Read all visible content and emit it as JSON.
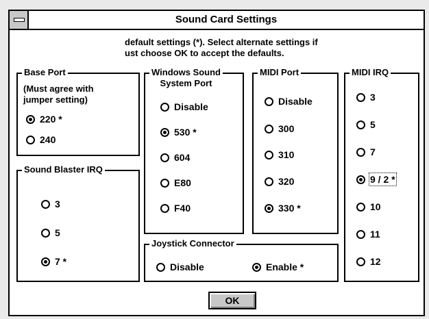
{
  "window": {
    "title": "Sound Card Settings"
  },
  "intro": {
    "line1": "default settings (*). Select alternate settings if",
    "line2": "ust choose OK to accept the defaults."
  },
  "base_port": {
    "legend": "Base Port",
    "note_line1": "(Must agree with",
    "note_line2": "jumper setting)",
    "options": [
      {
        "label": "220 *",
        "selected": true
      },
      {
        "label": "240",
        "selected": false
      }
    ]
  },
  "sound_blaster_irq": {
    "legend": "Sound Blaster IRQ",
    "options": [
      {
        "label": "3",
        "selected": false
      },
      {
        "label": "5",
        "selected": false
      },
      {
        "label": "7 *",
        "selected": true
      }
    ]
  },
  "wss_port": {
    "legend_line1": "Windows Sound",
    "legend_line2": "System Port",
    "options": [
      {
        "label": "Disable",
        "selected": false
      },
      {
        "label": "530 *",
        "selected": true
      },
      {
        "label": "604",
        "selected": false
      },
      {
        "label": "E80",
        "selected": false
      },
      {
        "label": "F40",
        "selected": false
      }
    ]
  },
  "midi_port": {
    "legend": "MIDI Port",
    "options": [
      {
        "label": "Disable",
        "selected": false
      },
      {
        "label": "300",
        "selected": false
      },
      {
        "label": "310",
        "selected": false
      },
      {
        "label": "320",
        "selected": false
      },
      {
        "label": "330 *",
        "selected": true
      }
    ]
  },
  "midi_irq": {
    "legend": "MIDI IRQ",
    "options": [
      {
        "label": "3",
        "selected": false
      },
      {
        "label": "5",
        "selected": false
      },
      {
        "label": "7",
        "selected": false
      },
      {
        "label": "9 / 2 *",
        "selected": true
      },
      {
        "label": "10",
        "selected": false
      },
      {
        "label": "11",
        "selected": false
      },
      {
        "label": "12",
        "selected": false
      }
    ]
  },
  "joystick": {
    "legend": "Joystick Connector",
    "options": [
      {
        "label": "Disable",
        "selected": false
      },
      {
        "label": "Enable *",
        "selected": true
      }
    ]
  },
  "ok_button": {
    "label": "OK"
  }
}
